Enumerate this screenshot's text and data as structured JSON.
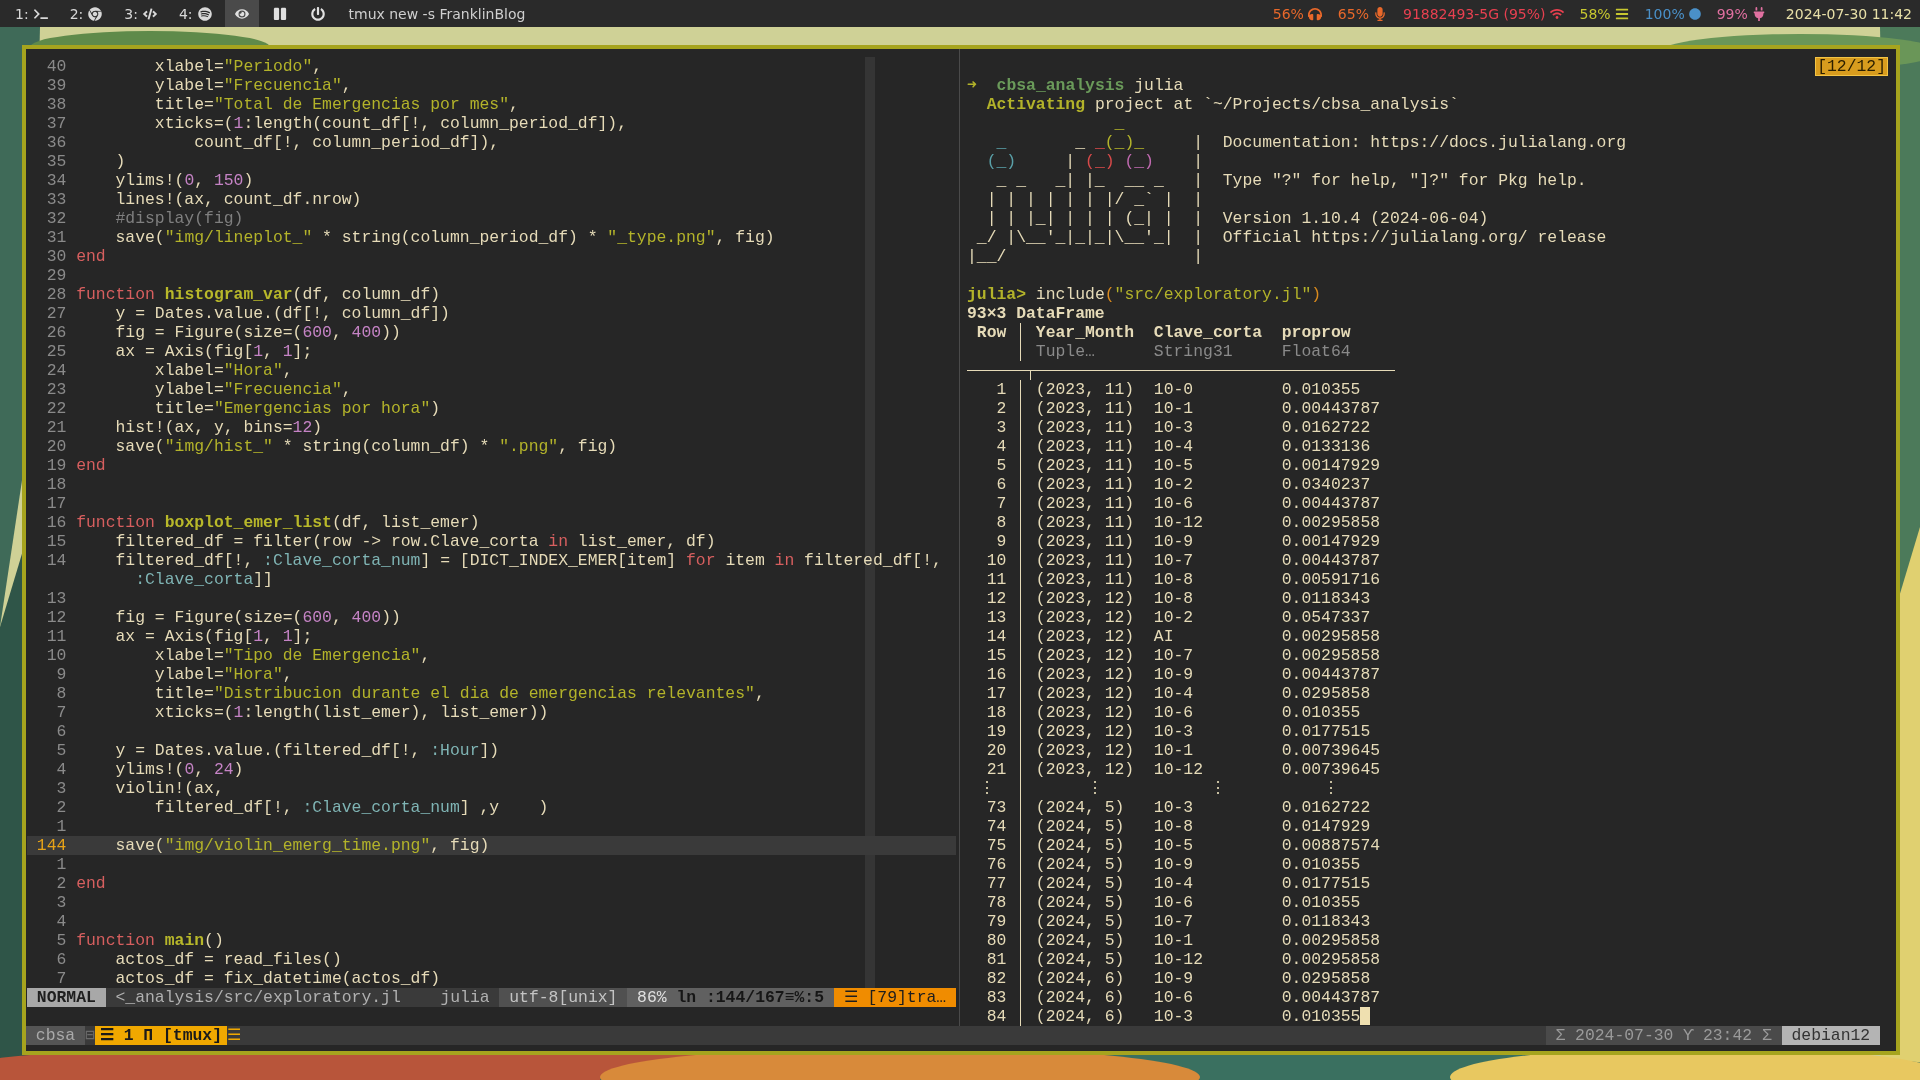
{
  "top_bar": {
    "workspaces": [
      {
        "label": "1:",
        "selected": false
      },
      {
        "label": "2:",
        "selected": false
      },
      {
        "label": "3:",
        "selected": false
      },
      {
        "label": "4:",
        "selected": false
      }
    ],
    "modes": [
      {
        "selected": true
      },
      {
        "selected": false
      },
      {
        "selected": false
      }
    ],
    "window_title": "tmux new -s FranklinBlog",
    "modules": [
      {
        "text": "56%",
        "color": "#e8682a"
      },
      {
        "text": "65%",
        "color": "#e8682a"
      },
      {
        "text": "91882493-5G (95%)",
        "color": "#e84050"
      },
      {
        "text": "58%",
        "color": "#c8c830"
      },
      {
        "text": "100%",
        "color": "#4a90c8"
      },
      {
        "text": "99%",
        "color": "#e070a0"
      }
    ],
    "clock": "2024-07-30 11:42"
  },
  "editor": {
    "lines": [
      {
        "number": "40",
        "current": false,
        "segments": [
          {
            "text": "        xlabel=",
            "kind": "plain"
          },
          {
            "text": "\"Periodo\"",
            "kind": "str"
          },
          {
            "text": ",",
            "kind": "plain"
          }
        ]
      },
      {
        "number": "39",
        "current": false,
        "segments": [
          {
            "text": "        ylabel=",
            "kind": "plain"
          },
          {
            "text": "\"Frecuencia\"",
            "kind": "str"
          },
          {
            "text": ",",
            "kind": "plain"
          }
        ]
      },
      {
        "number": "38",
        "current": false,
        "segments": [
          {
            "text": "        title=",
            "kind": "plain"
          },
          {
            "text": "\"Total de Emergencias por mes\"",
            "kind": "str"
          },
          {
            "text": ",",
            "kind": "plain"
          }
        ]
      },
      {
        "number": "37",
        "current": false,
        "segments": [
          {
            "text": "        xticks=(",
            "kind": "plain"
          },
          {
            "text": "1",
            "kind": "num"
          },
          {
            "text": ":length(count_df[!, column_period_df]),",
            "kind": "plain"
          }
        ]
      },
      {
        "number": "36",
        "current": false,
        "segments": [
          {
            "text": "            count_df[!, column_period_df]),",
            "kind": "plain"
          }
        ]
      },
      {
        "number": "35",
        "current": false,
        "segments": [
          {
            "text": "    )",
            "kind": "plain"
          }
        ]
      },
      {
        "number": "34",
        "current": false,
        "segments": [
          {
            "text": "    ylims!(",
            "kind": "plain"
          },
          {
            "text": "0",
            "kind": "num"
          },
          {
            "text": ", ",
            "kind": "plain"
          },
          {
            "text": "150",
            "kind": "num"
          },
          {
            "text": ")",
            "kind": "plain"
          }
        ]
      },
      {
        "number": "33",
        "current": false,
        "segments": [
          {
            "text": "    lines!(ax, count_df.nrow)",
            "kind": "plain"
          }
        ]
      },
      {
        "number": "32",
        "current": false,
        "segments": [
          {
            "text": "    #display(fig)",
            "kind": "comment"
          }
        ]
      },
      {
        "number": "31",
        "current": false,
        "segments": [
          {
            "text": "    save(",
            "kind": "plain"
          },
          {
            "text": "\"img/lineplot_\"",
            "kind": "str"
          },
          {
            "text": " * string(column_period_df) * ",
            "kind": "plain"
          },
          {
            "text": "\"_type.png\"",
            "kind": "str"
          },
          {
            "text": ", fig)",
            "kind": "plain"
          }
        ]
      },
      {
        "number": "30",
        "current": false,
        "segments": [
          {
            "text": "end",
            "kind": "kw"
          }
        ]
      },
      {
        "number": "29",
        "current": false
      },
      {
        "number": "28",
        "current": false,
        "segments": [
          {
            "text": "function ",
            "kind": "kw"
          },
          {
            "text": "histogram_var",
            "kind": "fn"
          },
          {
            "text": "(df, column_df)",
            "kind": "plain"
          }
        ]
      },
      {
        "number": "27",
        "current": false,
        "segments": [
          {
            "text": "    y = Dates.value.(df[!, column_df])",
            "kind": "plain"
          }
        ]
      },
      {
        "number": "26",
        "current": false,
        "segments": [
          {
            "text": "    fig = Figure(size=(",
            "kind": "plain"
          },
          {
            "text": "600",
            "kind": "num"
          },
          {
            "text": ", ",
            "kind": "plain"
          },
          {
            "text": "400",
            "kind": "num"
          },
          {
            "text": "))",
            "kind": "plain"
          }
        ]
      },
      {
        "number": "25",
        "current": false,
        "segments": [
          {
            "text": "    ax = Axis(fig[",
            "kind": "plain"
          },
          {
            "text": "1",
            "kind": "num"
          },
          {
            "text": ", ",
            "kind": "plain"
          },
          {
            "text": "1",
            "kind": "num"
          },
          {
            "text": "];",
            "kind": "plain"
          }
        ]
      },
      {
        "number": "24",
        "current": false,
        "segments": [
          {
            "text": "        xlabel=",
            "kind": "plain"
          },
          {
            "text": "\"Hora\"",
            "kind": "str"
          },
          {
            "text": ",",
            "kind": "plain"
          }
        ]
      },
      {
        "number": "23",
        "current": false,
        "segments": [
          {
            "text": "        ylabel=",
            "kind": "plain"
          },
          {
            "text": "\"Frecuencia\"",
            "kind": "str"
          },
          {
            "text": ",",
            "kind": "plain"
          }
        ]
      },
      {
        "number": "22",
        "current": false,
        "segments": [
          {
            "text": "        title=",
            "kind": "plain"
          },
          {
            "text": "\"Emergencias por hora\"",
            "kind": "str"
          },
          {
            "text": ")",
            "kind": "plain"
          }
        ]
      },
      {
        "number": "21",
        "current": false,
        "segments": [
          {
            "text": "    hist!(ax, y, bins=",
            "kind": "plain"
          },
          {
            "text": "12",
            "kind": "num"
          },
          {
            "text": ")",
            "kind": "plain"
          }
        ]
      },
      {
        "number": "20",
        "current": false,
        "segments": [
          {
            "text": "    save(",
            "kind": "plain"
          },
          {
            "text": "\"img/hist_\"",
            "kind": "str"
          },
          {
            "text": " * string(column_df) * ",
            "kind": "plain"
          },
          {
            "text": "\".png\"",
            "kind": "str"
          },
          {
            "text": ", fig)",
            "kind": "plain"
          }
        ]
      },
      {
        "number": "19",
        "current": false,
        "segments": [
          {
            "text": "end",
            "kind": "kw"
          }
        ]
      },
      {
        "number": "18",
        "current": false
      },
      {
        "number": "17",
        "current": false
      },
      {
        "number": "16",
        "current": false,
        "segments": [
          {
            "text": "function ",
            "kind": "kw"
          },
          {
            "text": "boxplot_emer_list",
            "kind": "fn"
          },
          {
            "text": "(df, list_emer)",
            "kind": "plain"
          }
        ]
      },
      {
        "number": "15",
        "current": false,
        "segments": [
          {
            "text": "    filtered_df = filter(row -> row.Clave_corta ",
            "kind": "plain"
          },
          {
            "text": "in",
            "kind": "kw"
          },
          {
            "text": " list_emer, df)",
            "kind": "plain"
          }
        ]
      },
      {
        "number": "14",
        "current": false,
        "segments": [
          {
            "text": "    filtered_df[!, ",
            "kind": "plain"
          },
          {
            "text": ":Clave_corta_num",
            "kind": "sym"
          },
          {
            "text": "] = [DICT_INDEX_EMER[item] ",
            "kind": "plain"
          },
          {
            "text": "for",
            "kind": "kw"
          },
          {
            "text": " item ",
            "kind": "plain"
          },
          {
            "text": "in",
            "kind": "kw"
          },
          {
            "text": " filtered_df[!,",
            "kind": "plain"
          }
        ]
      },
      {
        "current": false,
        "segments": [
          {
            "text": ":Clave_corta",
            "kind": "sym"
          },
          {
            "text": "]]",
            "kind": "plain"
          }
        ]
      },
      {
        "number": "13",
        "current": false
      },
      {
        "number": "12",
        "current": false,
        "segments": [
          {
            "text": "    fig = Figure(size=(",
            "kind": "plain"
          },
          {
            "text": "600",
            "kind": "num"
          },
          {
            "text": ", ",
            "kind": "plain"
          },
          {
            "text": "400",
            "kind": "num"
          },
          {
            "text": "))",
            "kind": "plain"
          }
        ]
      },
      {
        "number": "11",
        "current": false,
        "segments": [
          {
            "text": "    ax = Axis(fig[",
            "kind": "plain"
          },
          {
            "text": "1",
            "kind": "num"
          },
          {
            "text": ", ",
            "kind": "plain"
          },
          {
            "text": "1",
            "kind": "num"
          },
          {
            "text": "];",
            "kind": "plain"
          }
        ]
      },
      {
        "number": "10",
        "current": false,
        "segments": [
          {
            "text": "        xlabel=",
            "kind": "plain"
          },
          {
            "text": "\"Tipo de Emergencia\"",
            "kind": "str"
          },
          {
            "text": ",",
            "kind": "plain"
          }
        ]
      },
      {
        "number": "9",
        "current": false,
        "segments": [
          {
            "text": "        ylabel=",
            "kind": "plain"
          },
          {
            "text": "\"Hora\"",
            "kind": "str"
          },
          {
            "text": ",",
            "kind": "plain"
          }
        ]
      },
      {
        "number": "8",
        "current": false,
        "segments": [
          {
            "text": "        title=",
            "kind": "plain"
          },
          {
            "text": "\"Distribucion durante el dia de emergencias relevantes\"",
            "kind": "str"
          },
          {
            "text": ",",
            "kind": "plain"
          }
        ]
      },
      {
        "number": "7",
        "current": false,
        "segments": [
          {
            "text": "        xticks=(",
            "kind": "plain"
          },
          {
            "text": "1",
            "kind": "num"
          },
          {
            "text": ":length(list_emer), list_emer))",
            "kind": "plain"
          }
        ]
      },
      {
        "number": "6",
        "current": false
      },
      {
        "number": "5",
        "current": false,
        "segments": [
          {
            "text": "    y = Dates.value.(filtered_df[!, ",
            "kind": "plain"
          },
          {
            "text": ":Hour",
            "kind": "sym"
          },
          {
            "text": "])",
            "kind": "plain"
          }
        ]
      },
      {
        "number": "4",
        "current": false,
        "segments": [
          {
            "text": "    ylims!(",
            "kind": "plain"
          },
          {
            "text": "0",
            "kind": "num"
          },
          {
            "text": ", ",
            "kind": "plain"
          },
          {
            "text": "24",
            "kind": "num"
          },
          {
            "text": ")",
            "kind": "plain"
          }
        ]
      },
      {
        "number": "3",
        "current": false,
        "segments": [
          {
            "text": "    violin!(ax,",
            "kind": "plain"
          }
        ]
      },
      {
        "number": "2",
        "current": false,
        "segments": [
          {
            "text": "        filtered_df[!, ",
            "kind": "plain"
          },
          {
            "text": ":Clave_corta_num",
            "kind": "sym"
          },
          {
            "text": "] ,y    )",
            "kind": "plain"
          }
        ]
      },
      {
        "number": "1",
        "current": false
      },
      {
        "number": "144",
        "current": true,
        "segments": [
          {
            "text": "    save(",
            "kind": "plain"
          },
          {
            "text": "\"img/violin_emerg_time.png\"",
            "kind": "str"
          },
          {
            "text": ", fig)",
            "kind": "plain"
          }
        ]
      },
      {
        "number": "1",
        "current": false
      },
      {
        "number": "2",
        "current": false,
        "segments": [
          {
            "text": "end",
            "kind": "kw"
          }
        ]
      },
      {
        "number": "3",
        "current": false
      },
      {
        "number": "4",
        "current": false
      },
      {
        "number": "5",
        "current": false,
        "segments": [
          {
            "text": "function ",
            "kind": "kw"
          },
          {
            "text": "main",
            "kind": "fn"
          },
          {
            "text": "()",
            "kind": "plain"
          }
        ]
      },
      {
        "number": "6",
        "current": false,
        "segments": [
          {
            "text": "    actos_df = read_files()",
            "kind": "plain"
          }
        ]
      },
      {
        "number": "7",
        "current": false,
        "segments": [
          {
            "text": "    actos_df = fix_datetime(actos_df)",
            "kind": "plain"
          }
        ]
      }
    ],
    "status_line": [
      {
        "kind": "mode",
        "text": "NORMAL"
      },
      {
        "kind": "file",
        "text": "<_analysis/src/exploratory.jl"
      },
      {
        "kind": "filetype",
        "text": "julia"
      },
      {
        "kind": "encoding",
        "text": "utf-8[unix]"
      },
      {
        "kind": "percent",
        "text": "86%"
      },
      {
        "kind": "position",
        "text": "ln :144/167≡%:5"
      },
      {
        "kind": "warning",
        "text": "☰ [79]tra…"
      }
    ]
  },
  "terminal": {
    "indicator": "[12/12]",
    "header_lines": [
      [
        {
          "text": "➜ ",
          "kind": "prompt"
        },
        {
          "text": " cbsa_analysis",
          "kind": "dir"
        },
        {
          "text": " julia",
          "kind": "plain"
        }
      ],
      [
        {
          "text": "  Activating",
          "kind": "prompt"
        },
        {
          "text": " project at `~/Projects/cbsa_analysis`",
          "kind": "plain"
        }
      ],
      [
        {
          "text": "               _",
          "kind": "olive"
        }
      ],
      [
        {
          "text": "   _",
          "kind": "teal"
        },
        {
          "text": "       _ ",
          "kind": "plain"
        },
        {
          "text": "_",
          "kind": "red"
        },
        {
          "text": "(_)_",
          "kind": "olive"
        },
        {
          "text": "     |  Documentation: https://docs.julialang.org",
          "kind": "plain"
        }
      ],
      [
        {
          "text": "  (_)",
          "kind": "teal"
        },
        {
          "text": "     | ",
          "kind": "plain"
        },
        {
          "text": "(_)",
          "kind": "red"
        },
        {
          "text": " (_)",
          "kind": "purple"
        },
        {
          "text": "    |",
          "kind": "plain"
        }
      ],
      [
        {
          "text": "   _ _   _| |_  __ _   |  Type \"?\" for help, \"]?\" for Pkg help.",
          "kind": "plain"
        }
      ],
      [
        {
          "text": "  | | | | | | |/ _` |  |",
          "kind": "plain"
        }
      ],
      [
        {
          "text": "  | | |_| | | | (_| |  |  Version 1.10.4 (2024-06-04)",
          "kind": "plain"
        }
      ],
      [
        {
          "text": " _/ |\\__'_|_|_|\\__'_|  |  Official https://julialang.org/ release",
          "kind": "plain"
        }
      ],
      [
        {
          "text": "|__/                   |",
          "kind": "plain"
        }
      ]
    ],
    "command": [
      {
        "text": "julia>",
        "kind": "prompt"
      },
      {
        "text": " include",
        "kind": "plain"
      },
      {
        "text": "(",
        "kind": "paren"
      },
      {
        "text": "\"src/exploratory.jl\"",
        "kind": "str"
      },
      {
        "text": ")",
        "kind": "paren"
      }
    ],
    "dataframe": {
      "title": "93×3 DataFrame",
      "row_header": "Row",
      "columns": [
        {
          "name": "Year_Month",
          "type": "Tuple…"
        },
        {
          "name": "Clave_corta",
          "type": "String31"
        },
        {
          "name": "proprow",
          "type": "Float64"
        }
      ],
      "rows": [
        {
          "row": "1",
          "cells": [
            "(2023, 11)",
            "10-0",
            "0.010355"
          ]
        },
        {
          "row": "2",
          "cells": [
            "(2023, 11)",
            "10-1",
            "0.00443787"
          ]
        },
        {
          "row": "3",
          "cells": [
            "(2023, 11)",
            "10-3",
            "0.0162722"
          ]
        },
        {
          "row": "4",
          "cells": [
            "(2023, 11)",
            "10-4",
            "0.0133136"
          ]
        },
        {
          "row": "5",
          "cells": [
            "(2023, 11)",
            "10-5",
            "0.00147929"
          ]
        },
        {
          "row": "6",
          "cells": [
            "(2023, 11)",
            "10-2",
            "0.0340237"
          ]
        },
        {
          "row": "7",
          "cells": [
            "(2023, 11)",
            "10-6",
            "0.00443787"
          ]
        },
        {
          "row": "8",
          "cells": [
            "(2023, 11)",
            "10-12",
            "0.00295858"
          ]
        },
        {
          "row": "9",
          "cells": [
            "(2023, 11)",
            "10-9",
            "0.00147929"
          ]
        },
        {
          "row": "10",
          "cells": [
            "(2023, 11)",
            "10-7",
            "0.00443787"
          ]
        },
        {
          "row": "11",
          "cells": [
            "(2023, 11)",
            "10-8",
            "0.00591716"
          ]
        },
        {
          "row": "12",
          "cells": [
            "(2023, 12)",
            "10-8",
            "0.0118343"
          ]
        },
        {
          "row": "13",
          "cells": [
            "(2023, 12)",
            "10-2",
            "0.0547337"
          ]
        },
        {
          "row": "14",
          "cells": [
            "(2023, 12)",
            "AI",
            "0.00295858"
          ]
        },
        {
          "row": "15",
          "cells": [
            "(2023, 12)",
            "10-7",
            "0.00295858"
          ]
        },
        {
          "row": "16",
          "cells": [
            "(2023, 12)",
            "10-9",
            "0.00443787"
          ]
        },
        {
          "row": "17",
          "cells": [
            "(2023, 12)",
            "10-4",
            "0.0295858"
          ]
        },
        {
          "row": "18",
          "cells": [
            "(2023, 12)",
            "10-6",
            "0.010355"
          ]
        },
        {
          "row": "19",
          "cells": [
            "(2023, 12)",
            "10-3",
            "0.0177515"
          ]
        },
        {
          "row": "20",
          "cells": [
            "(2023, 12)",
            "10-1",
            "0.00739645"
          ]
        },
        {
          "row": "21",
          "cells": [
            "(2023, 12)",
            "10-12",
            "0.00739645"
          ]
        }
      ],
      "ellipsis": [
        "⋮",
        "⋮",
        "⋮",
        "⋮"
      ],
      "more_rows": [
        {
          "row": "73",
          "cells": [
            "(2024, 5)",
            "10-3",
            "0.0162722"
          ]
        },
        {
          "row": "74",
          "cells": [
            "(2024, 5)",
            "10-8",
            "0.0147929"
          ]
        },
        {
          "row": "75",
          "cells": [
            "(2024, 5)",
            "10-5",
            "0.00887574"
          ]
        },
        {
          "row": "76",
          "cells": [
            "(2024, 5)",
            "10-9",
            "0.010355"
          ]
        },
        {
          "row": "77",
          "cells": [
            "(2024, 5)",
            "10-4",
            "0.0177515"
          ]
        },
        {
          "row": "78",
          "cells": [
            "(2024, 5)",
            "10-6",
            "0.010355"
          ]
        },
        {
          "row": "79",
          "cells": [
            "(2024, 5)",
            "10-7",
            "0.0118343"
          ]
        },
        {
          "row": "80",
          "cells": [
            "(2024, 5)",
            "10-1",
            "0.00295858"
          ]
        },
        {
          "row": "81",
          "cells": [
            "(2024, 5)",
            "10-12",
            "0.00295858"
          ]
        },
        {
          "row": "82",
          "cells": [
            "(2024, 6)",
            "10-9",
            "0.0295858"
          ]
        },
        {
          "row": "83",
          "cells": [
            "(2024, 6)",
            "10-6",
            "0.00443787"
          ]
        },
        {
          "row": "84",
          "cells": [
            "(2024, 6)",
            "10-3",
            "0.010355"
          ]
        }
      ]
    },
    "cursor": true
  },
  "tmux": {
    "session": "cbsa",
    "separator": "⊟",
    "windows": [
      {
        "text": "☰ 1 Π [tmux]",
        "selected": true
      }
    ],
    "end_mark": "☰",
    "clock": "Σ 2024-07-30 ϒ 23:42 Σ",
    "host": "debian12"
  }
}
